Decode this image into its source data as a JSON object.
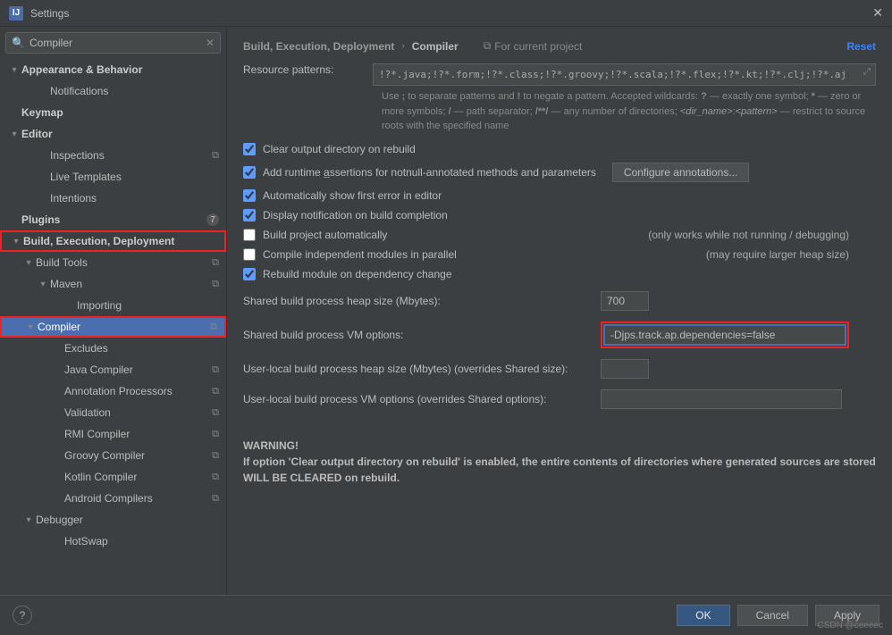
{
  "titlebar": {
    "icon": "IJ",
    "title": "Settings"
  },
  "sidebar": {
    "search": "Compiler",
    "items": [
      {
        "label": "Appearance & Behavior",
        "bold": true,
        "arrow": "▾",
        "indent": 0
      },
      {
        "label": "Notifications",
        "indent": 2
      },
      {
        "label": "Keymap",
        "bold": true,
        "indent": 0
      },
      {
        "label": "Editor",
        "bold": true,
        "arrow": "▾",
        "indent": 0
      },
      {
        "label": "Inspections",
        "indent": 2,
        "copy": true
      },
      {
        "label": "Live Templates",
        "indent": 2
      },
      {
        "label": "Intentions",
        "indent": 2
      },
      {
        "label": "Plugins",
        "bold": true,
        "indent": 0,
        "circle": "7"
      },
      {
        "label": "Build, Execution, Deployment",
        "bold": true,
        "arrow": "▾",
        "indent": 0,
        "redbox": true
      },
      {
        "label": "Build Tools",
        "arrow": "▾",
        "indent": 1,
        "copy": true
      },
      {
        "label": "Maven",
        "arrow": "▾",
        "indent": 2,
        "copy": true
      },
      {
        "label": "Importing",
        "indent": 4
      },
      {
        "label": "Compiler",
        "arrow": "▾",
        "indent": 1,
        "selected": true,
        "copy": true,
        "redbox": true
      },
      {
        "label": "Excludes",
        "indent": 3
      },
      {
        "label": "Java Compiler",
        "indent": 3,
        "copy": true
      },
      {
        "label": "Annotation Processors",
        "indent": 3,
        "copy": true
      },
      {
        "label": "Validation",
        "indent": 3,
        "copy": true
      },
      {
        "label": "RMI Compiler",
        "indent": 3,
        "copy": true
      },
      {
        "label": "Groovy Compiler",
        "indent": 3,
        "copy": true
      },
      {
        "label": "Kotlin Compiler",
        "indent": 3,
        "copy": true
      },
      {
        "label": "Android Compilers",
        "indent": 3,
        "copy": true
      },
      {
        "label": "Debugger",
        "arrow": "▾",
        "indent": 1
      },
      {
        "label": "HotSwap",
        "indent": 3
      }
    ]
  },
  "header": {
    "crumb1": "Build, Execution, Deployment",
    "crumb2": "Compiler",
    "for_project": "For current project",
    "reset": "Reset"
  },
  "content": {
    "resource_label": "Resource patterns:",
    "resource_value": "!?*.java;!?*.form;!?*.class;!?*.groovy;!?*.scala;!?*.flex;!?*.kt;!?*.clj;!?*.aj",
    "help_text_a": "Use ",
    "help_text_b": " to separate patterns and ",
    "help_text_c": " to negate a pattern. Accepted wildcards: ",
    "help_text_d": " — exactly one symbol; ",
    "help_text_e": " — zero or more symbols; ",
    "help_text_f": " — path separator; ",
    "help_text_g": " — any number of directories; ",
    "help_text_h": " — restrict to source roots with the specified name",
    "c1": "Clear output directory on rebuild",
    "c2_a": "Add runtime ",
    "c2_u": "a",
    "c2_b": "ssertions for notnull-annotated methods and parameters",
    "c2_btn": "Configure annotations...",
    "c3": "Automatically show first error in editor",
    "c4": "Display notification on build completion",
    "c5": "Build project automatically",
    "c5_aside": "(only works while not running / debugging)",
    "c6": "Compile independent modules in parallel",
    "c6_aside": "(may require larger heap size)",
    "c7": "Rebuild module on dependency change",
    "r1_label": "Shared build process heap size (Mbytes):",
    "r1_value": "700",
    "r2_label": "Shared build process VM options:",
    "r2_value": "-Djps.track.ap.dependencies=false",
    "r3_label": "User-local build process heap size (Mbytes) (overrides Shared size):",
    "r3_value": "",
    "r4_label": "User-local build process VM options (overrides Shared options):",
    "r4_value": "",
    "warning_title": "WARNING!",
    "warning_body": "If option 'Clear output directory on rebuild' is enabled, the entire contents of directories where generated sources are stored WILL BE CLEARED on rebuild."
  },
  "footer": {
    "ok": "OK",
    "cancel": "Cancel",
    "apply": "Apply"
  },
  "watermark": "CSDN @ceeeec"
}
